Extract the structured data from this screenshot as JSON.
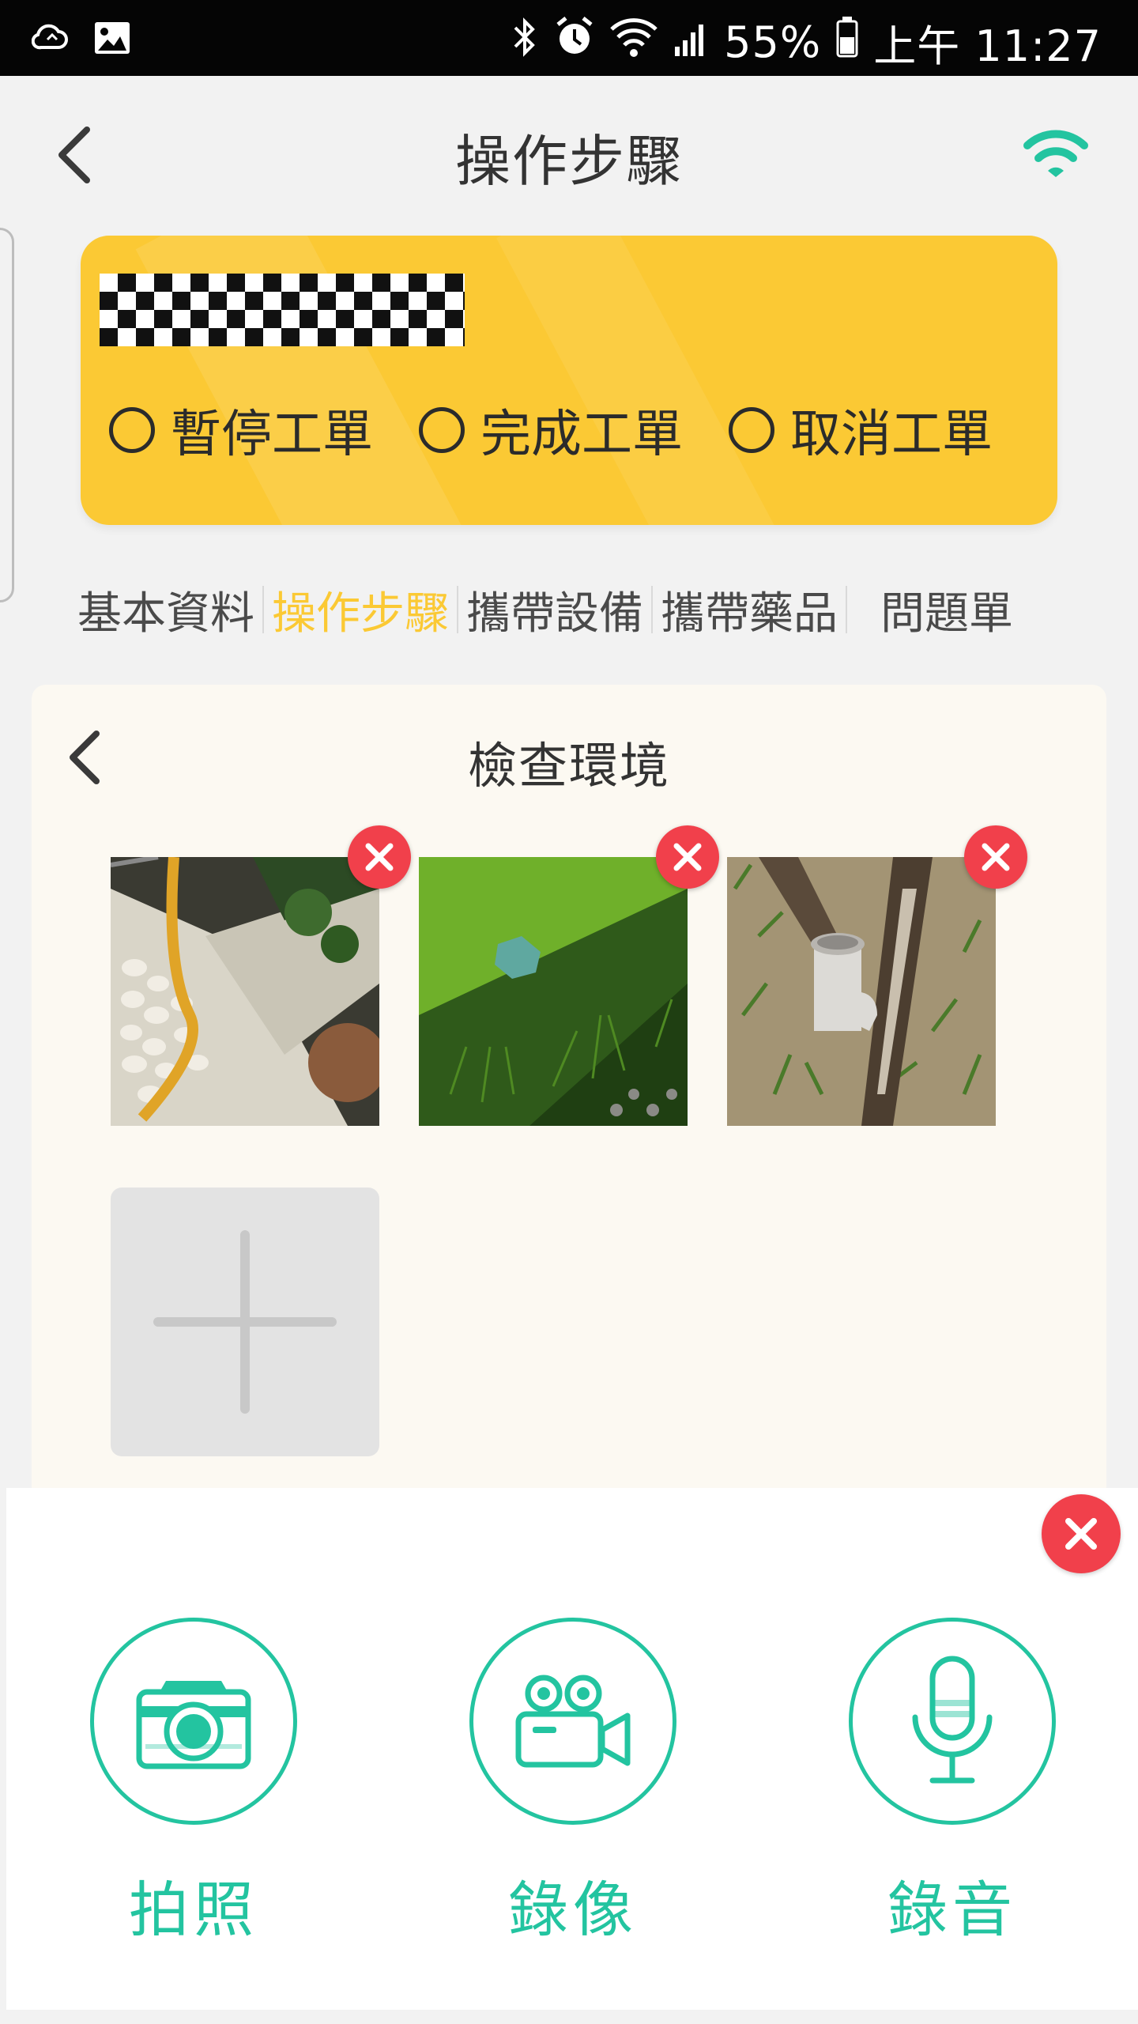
{
  "status_bar": {
    "battery": "55%",
    "time": "上午 11:27"
  },
  "header": {
    "title": "操作步驟"
  },
  "order_card": {
    "options": [
      {
        "label": "暫停工單"
      },
      {
        "label": "完成工單"
      },
      {
        "label": "取消工單"
      }
    ]
  },
  "tabs": [
    {
      "label": "基本資料",
      "active": false
    },
    {
      "label": "操作步驟",
      "active": true
    },
    {
      "label": "攜帶設備",
      "active": false
    },
    {
      "label": "攜帶藥品",
      "active": false
    },
    {
      "label": "問題單",
      "active": false
    }
  ],
  "step": {
    "title": "檢查環境",
    "photos": [
      {
        "subject": "garden-hose-stones"
      },
      {
        "subject": "lawn-grass"
      },
      {
        "subject": "pipe-between-trees"
      }
    ]
  },
  "media_sheet": {
    "buttons": [
      {
        "label": "拍照",
        "icon": "camera-icon"
      },
      {
        "label": "錄像",
        "icon": "video-camera-icon"
      },
      {
        "label": "錄音",
        "icon": "microphone-icon"
      }
    ]
  },
  "colors": {
    "accent_yellow": "#fbc934",
    "accent_teal": "#23c4a0",
    "delete_red": "#f1404b"
  }
}
